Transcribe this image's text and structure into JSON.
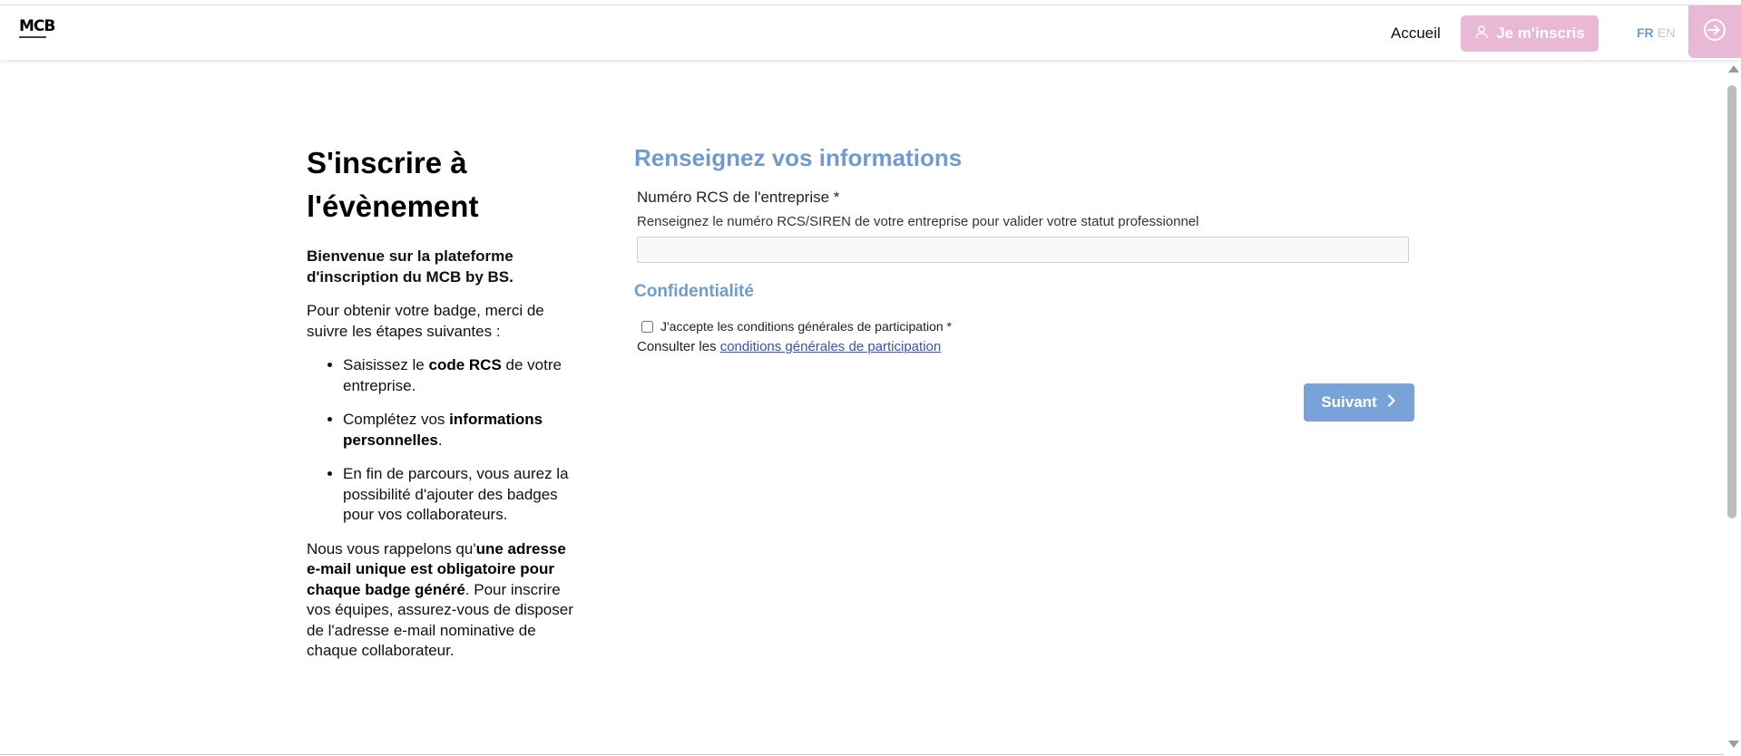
{
  "header": {
    "logo_text": "MCB",
    "home_label": "Accueil",
    "register_label": "Je m'inscris",
    "lang_fr": "FR",
    "lang_en": "EN",
    "icons": {
      "register": "user-icon",
      "login": "sign-in-icon"
    },
    "colors": {
      "pink": "#e9b8d5",
      "blue": "#6f9bd0"
    }
  },
  "intro": {
    "title": "S'inscrire à l'évènement",
    "welcome": "Bienvenue sur la plateforme d'inscription du MCB by BS.",
    "steps_intro": "Pour obtenir votre badge, merci de suivre les étapes suivantes :",
    "step1": {
      "before": "Saisissez le ",
      "strong": "code RCS",
      "after": " de votre entreprise."
    },
    "step2": {
      "before": "Complétez vos ",
      "strong": "informations personnelles",
      "after": "."
    },
    "step3": "En fin de parcours, vous aurez la possibilité d'ajouter des badges pour vos collaborateurs.",
    "reminder": {
      "before": "Nous vous rappelons qu'",
      "strong": "une adresse e-mail unique est obligatoire pour chaque badge généré",
      "after": ". Pour inscrire vos équipes, assurez-vous de disposer de l'adresse e-mail nominative de chaque collaborateur."
    }
  },
  "form": {
    "title": "Renseignez vos informations",
    "rcs_label": "Numéro RCS de l'entreprise *",
    "rcs_help": "Renseignez le numéro RCS/SIREN de votre entreprise pour valider votre statut professionnel",
    "rcs_value": "",
    "privacy_title": "Confidentialité",
    "accept_label": "J'accepte les conditions générales de participation *",
    "consult_text": "Consulter les ",
    "consult_link": "conditions générales de participation",
    "next_label": "Suivant"
  }
}
